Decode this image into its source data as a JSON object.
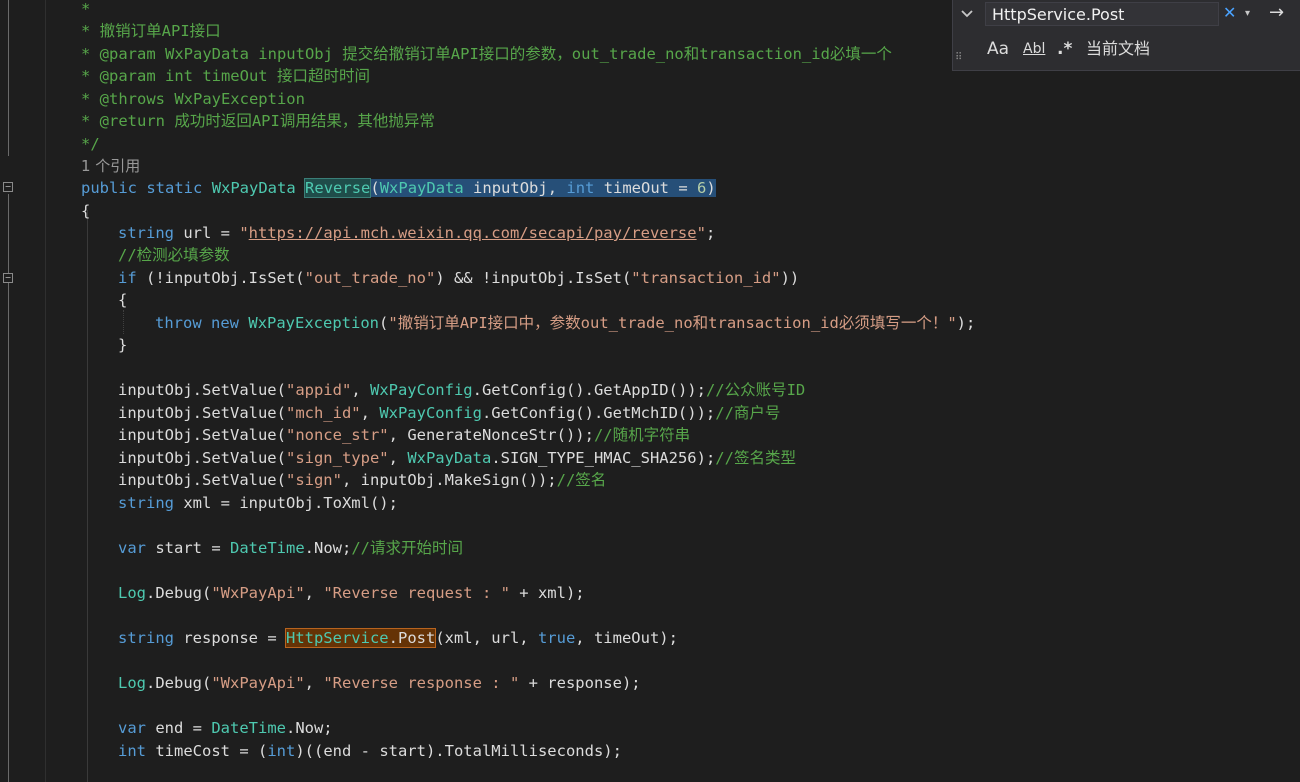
{
  "editor": {
    "doc": {
      "c1": "*",
      "c2": "* 撤销订单API接口",
      "c3": "* @param WxPayData inputObj 提交给撤销订单API接口的参数，out_trade_no和transaction_id必填一个",
      "c4": "* @param int timeOut 接口超时时间",
      "c5": "* @throws WxPayException",
      "c6": "* @return 成功时返回API调用结果，其他抛异常",
      "c7": "*/"
    },
    "codelens": "1 个引用",
    "sig": {
      "public": "public",
      "static": "static",
      "ret_type": "WxPayData",
      "method": "Reverse",
      "open": "(",
      "p1_type": "WxPayData",
      "p1_name": " inputObj, ",
      "p2_type": "int",
      "p2_name": " timeOut = ",
      "p2_default": "6",
      "close": ")"
    },
    "brace_open": "{",
    "url_line": {
      "kw": "string",
      "mid": " url = ",
      "q1": "\"",
      "url": "https://api.mch.weixin.qq.com/secapi/pay/reverse",
      "q2": "\"",
      "end": ";"
    },
    "check_comment": "//检测必填参数",
    "if_line": {
      "kw": "if",
      "a": " (!inputObj.IsSet(",
      "s1": "\"out_trade_no\"",
      "b": ") && !inputObj.IsSet(",
      "s2": "\"transaction_id\"",
      "c": "))"
    },
    "inner_open": "{",
    "throw_line": {
      "kw1": "throw",
      "kw2": "new",
      "type": "WxPayException",
      "a": "(",
      "s": "\"撤销订单API接口中，参数out_trade_no和transaction_id必须填写一个！\"",
      "b": ");"
    },
    "inner_close": "}",
    "set_lines": [
      {
        "a": "inputObj.SetValue(",
        "s": "\"appid\"",
        "b": ", ",
        "t": "WxPayConfig",
        "c": ".GetConfig().GetAppID());",
        "cm": "//公众账号ID"
      },
      {
        "a": "inputObj.SetValue(",
        "s": "\"mch_id\"",
        "b": ", ",
        "t": "WxPayConfig",
        "c": ".GetConfig().GetMchID());",
        "cm": "//商户号"
      },
      {
        "a": "inputObj.SetValue(",
        "s": "\"nonce_str\"",
        "b": ", ",
        "t": "",
        "c": "GenerateNonceStr());",
        "cm": "//随机字符串"
      },
      {
        "a": "inputObj.SetValue(",
        "s": "\"sign_type\"",
        "b": ", ",
        "t": "WxPayData",
        "c": ".SIGN_TYPE_HMAC_SHA256);",
        "cm": "//签名类型"
      },
      {
        "a": "inputObj.SetValue(",
        "s": "\"sign\"",
        "b": ", ",
        "t": "",
        "c": "inputObj.MakeSign());",
        "cm": "//签名"
      }
    ],
    "xml_line": {
      "kw": "string",
      "rest": " xml = inputObj.ToXml();"
    },
    "start_line": {
      "kw": "var",
      "a": " start = ",
      "t": "DateTime",
      "b": ".Now;",
      "cm": "//请求开始时间"
    },
    "log1": {
      "t": "Log",
      "a": ".Debug(",
      "s1": "\"WxPayApi\"",
      "b": ", ",
      "s2": "\"Reverse request : \"",
      "c": " + xml);"
    },
    "resp_line": {
      "kw": "string",
      "a": " response = ",
      "t": "HttpService",
      "b": ".",
      "m": "Post",
      "c": "(xml, url, ",
      "kw2": "true",
      "d": ", timeOut);"
    },
    "log2": {
      "t": "Log",
      "a": ".Debug(",
      "s1": "\"WxPayApi\"",
      "b": ", ",
      "s2": "\"Reverse response : \"",
      "c": " + response);"
    },
    "end_line": {
      "kw": "var",
      "a": " end = ",
      "t": "DateTime",
      "b": ".Now;"
    },
    "cost_line": {
      "kw": "int",
      "a": " timeCost = (",
      "kw2": "int",
      "b": ")((end - start).TotalMilliseconds);"
    }
  },
  "find_widget": {
    "toggle_icon": "chevron-down-icon",
    "query": "HttpService.Post",
    "clear_glyph": "✕",
    "dropdown_glyph": "▾",
    "next_glyph": "→",
    "match_case": "Aa",
    "whole_word": "Abl",
    "regex": ".*",
    "scope": "当前文档",
    "grip": "⠿"
  }
}
